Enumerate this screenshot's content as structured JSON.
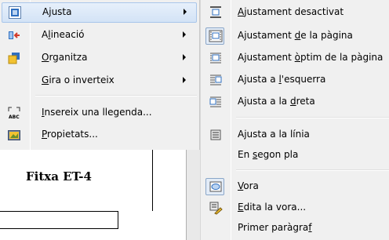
{
  "parent_menu": {
    "items": [
      {
        "pre": "A",
        "ak": "j",
        "post": "usta",
        "icon": "wrap-icon",
        "submenu": true,
        "highlighted": true
      },
      {
        "pre": "A",
        "ak": "l",
        "post": "ineació",
        "icon": "align-icon",
        "submenu": true
      },
      {
        "pre": "",
        "ak": "O",
        "post": "rganitza",
        "icon": "arrange-icon",
        "submenu": true
      },
      {
        "pre": "",
        "ak": "G",
        "post": "ira o inverteix",
        "icon": "",
        "submenu": true
      },
      {
        "pre": "",
        "ak": "I",
        "post": "nsereix una llegenda...",
        "icon": "insert-caption-icon",
        "submenu": false
      },
      {
        "pre": "",
        "ak": "P",
        "post": "ropietats...",
        "icon": "properties-icon",
        "submenu": false
      }
    ]
  },
  "document": {
    "title": "Fitxa  ET-4"
  },
  "submenu": {
    "items": [
      {
        "pre": "",
        "ak": "A",
        "post": "justament desactivat",
        "icon": "wrap-off-icon"
      },
      {
        "pre": "Ajustament ",
        "ak": "d",
        "post": "e la pàgina",
        "icon": "wrap-page-icon",
        "checked": true
      },
      {
        "pre": "Ajustament ",
        "ak": "ò",
        "post": "ptim de la pàgina",
        "icon": "wrap-optimal-icon"
      },
      {
        "pre": "Ajusta a ",
        "ak": "l",
        "post": "'esquerra",
        "icon": "wrap-left-icon"
      },
      {
        "pre": "Ajusta a la ",
        "ak": "d",
        "post": "reta",
        "icon": "wrap-right-icon"
      },
      {
        "pre": "Ajusta a la línia",
        "ak": "",
        "post": "",
        "icon": "wrap-through-icon"
      },
      {
        "pre": "En ",
        "ak": "s",
        "post": "egon pla",
        "icon": ""
      },
      {
        "pre": "",
        "ak": "V",
        "post": "ora",
        "icon": "contour-icon",
        "checked": true
      },
      {
        "pre": "",
        "ak": "E",
        "post": "dita la vora...",
        "icon": "edit-contour-icon"
      },
      {
        "pre": "Primer paràgra",
        "ak": "f",
        "post": "",
        "icon": ""
      }
    ]
  },
  "colors": {
    "menu_bg": "#f0f0f0",
    "highlight_bg": "#dbe8f8",
    "highlight_border": "#a9c6ea",
    "icon_blue": "#2f6fc0",
    "icon_yellow": "#f2c230"
  }
}
